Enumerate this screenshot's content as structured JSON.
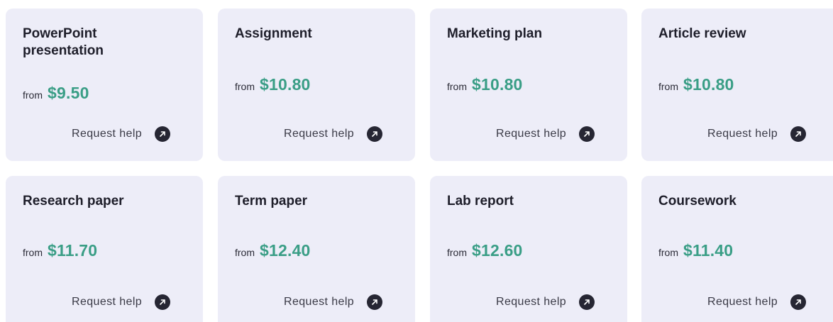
{
  "cards": [
    {
      "title": "PowerPoint presentation",
      "from_label": "from",
      "price": "$9.50",
      "cta": "Request help"
    },
    {
      "title": "Assignment",
      "from_label": "from",
      "price": "$10.80",
      "cta": "Request help"
    },
    {
      "title": "Marketing plan",
      "from_label": "from",
      "price": "$10.80",
      "cta": "Request help"
    },
    {
      "title": "Article review",
      "from_label": "from",
      "price": "$10.80",
      "cta": "Request help"
    },
    {
      "title": "Research paper",
      "from_label": "from",
      "price": "$11.70",
      "cta": "Request help"
    },
    {
      "title": "Term paper",
      "from_label": "from",
      "price": "$12.40",
      "cta": "Request help"
    },
    {
      "title": "Lab report",
      "from_label": "from",
      "price": "$12.60",
      "cta": "Request help"
    },
    {
      "title": "Coursework",
      "from_label": "from",
      "price": "$11.40",
      "cta": "Request help"
    }
  ],
  "icons": {
    "request": "arrow-up-right-icon"
  },
  "colors": {
    "card_background": "#ededf8",
    "price": "#3a9e86",
    "title": "#1e1e2a",
    "icon_background": "#262633"
  }
}
